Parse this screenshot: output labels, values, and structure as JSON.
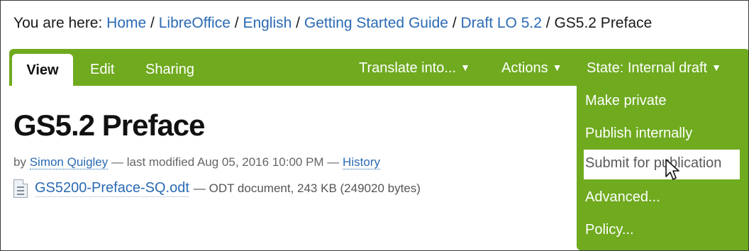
{
  "breadcrumb": {
    "prefix": "You are here:",
    "items": [
      "Home",
      "LibreOffice",
      "English",
      "Getting Started Guide",
      "Draft LO 5.2"
    ],
    "current": "GS5.2 Preface",
    "separator": "/"
  },
  "tabs": {
    "active": "View",
    "items": [
      "Edit",
      "Sharing"
    ]
  },
  "menu": {
    "translate": "Translate into...",
    "actions": "Actions",
    "state": "State: Internal draft",
    "caret": "▼"
  },
  "dropdown": {
    "items": [
      "Make private",
      "Publish internally",
      "Submit for publication",
      "Advanced...",
      "Policy..."
    ],
    "hovered_index": 2
  },
  "content": {
    "title": "GS5.2 Preface",
    "by": "by",
    "author": "Simon Quigley",
    "modified": "— last modified Aug 05, 2016 10:00 PM —",
    "history": "History",
    "file_name": "GS5200-Preface-SQ.odt",
    "file_info": "— ODT document, 243 KB (249020 bytes)"
  },
  "colors": {
    "accent": "#6faa1f",
    "link": "#2a6ab3"
  }
}
